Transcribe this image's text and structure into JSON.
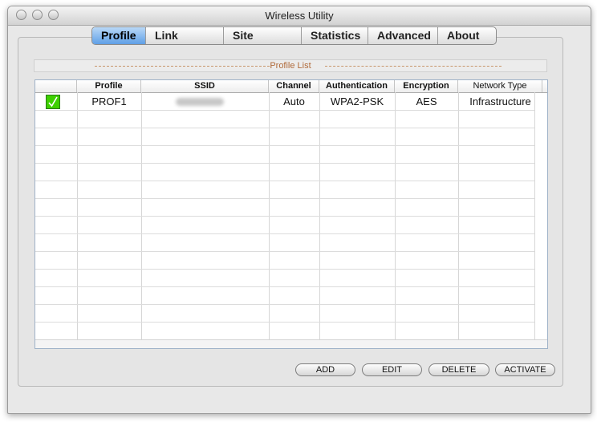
{
  "window": {
    "title": "Wireless Utility"
  },
  "tabs": [
    {
      "label": "Profile",
      "active": true
    },
    {
      "label": "Link Status"
    },
    {
      "label": "Site Survey"
    },
    {
      "label": "Statistics"
    },
    {
      "label": "Advanced"
    },
    {
      "label": "About"
    }
  ],
  "profile_list": {
    "section_label": "Profile List",
    "columns": [
      "",
      "Profile",
      "SSID",
      "Channel",
      "Authentication",
      "Encryption",
      "Network Type"
    ],
    "rows": [
      {
        "active": true,
        "profile": "PROF1",
        "ssid": "",
        "channel": "Auto",
        "authentication": "WPA2-PSK",
        "encryption": "AES",
        "network_type": "Infrastructure"
      }
    ]
  },
  "buttons": {
    "add": "ADD",
    "edit": "EDIT",
    "delete": "DELETE",
    "activate": "ACTIVATE"
  },
  "colors": {
    "active_tab": "#5f9fe6",
    "active_check": "#3ed000",
    "section_label": "#b06a3a"
  },
  "icons": {
    "active_profile": "checkmark-icon"
  }
}
